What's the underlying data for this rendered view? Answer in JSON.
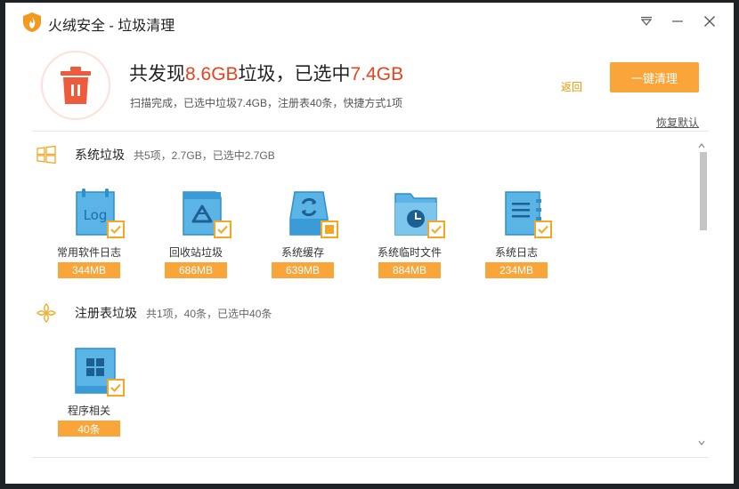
{
  "window": {
    "title": "火绒安全 - 垃圾清理"
  },
  "summary": {
    "headline_prefix": "共发现",
    "found_size": "8.6GB",
    "headline_middle": "垃圾，已选中",
    "selected_size": "7.4GB",
    "subline": "扫描完成，已选中垃圾7.4GB，注册表40条，快捷方式1项",
    "back_label": "返回",
    "clean_label": "一键清理",
    "restore_label": "恢复默认"
  },
  "sections": [
    {
      "title": "系统垃圾",
      "meta": "共5项，2.7GB，已选中2.7GB",
      "icon": "windows-icon",
      "items": [
        {
          "name": "常用软件日志",
          "size": "344MB",
          "icon": "log-folder-icon",
          "check": "checked"
        },
        {
          "name": "回收站垃圾",
          "size": "686MB",
          "icon": "recycle-bin-icon",
          "check": "checked"
        },
        {
          "name": "系统缓存",
          "size": "639MB",
          "icon": "cache-icon",
          "check": "partial"
        },
        {
          "name": "系统临时文件",
          "size": "884MB",
          "icon": "temp-folder-icon",
          "check": "checked"
        },
        {
          "name": "系统日志",
          "size": "234MB",
          "icon": "system-log-icon",
          "check": "checked"
        }
      ]
    },
    {
      "title": "注册表垃圾",
      "meta": "共1项，40条，已选中40条",
      "icon": "registry-icon",
      "items": [
        {
          "name": "程序相关",
          "size": "40条",
          "icon": "program-registry-icon",
          "check": "checked"
        }
      ]
    }
  ],
  "colors": {
    "accent": "#f9a53a",
    "highlight": "#e8431e",
    "icon_blue": "#5ab4e5",
    "trash_red": "#ef5a3c"
  }
}
